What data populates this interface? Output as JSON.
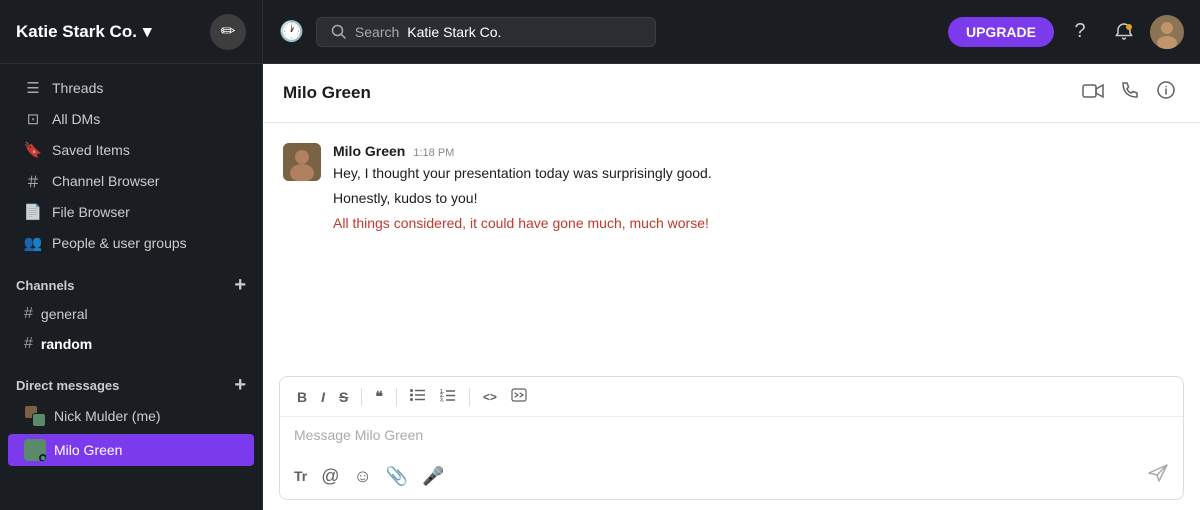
{
  "workspace": {
    "name": "Katie Stark Co.",
    "chevron": "▾"
  },
  "topbar": {
    "search_placeholder": "Search",
    "search_context": "Katie Stark Co.",
    "upgrade_label": "UPGRADE"
  },
  "sidebar": {
    "nav_items": [
      {
        "id": "threads",
        "label": "Threads",
        "icon": "☰"
      },
      {
        "id": "all-dms",
        "label": "All DMs",
        "icon": "⊞"
      },
      {
        "id": "saved-items",
        "label": "Saved Items",
        "icon": "🔖"
      },
      {
        "id": "channel-browser",
        "label": "Channel Browser",
        "icon": "＃"
      },
      {
        "id": "file-browser",
        "label": "File Browser",
        "icon": "📄"
      },
      {
        "id": "people",
        "label": "People & user groups",
        "icon": "👥"
      }
    ],
    "channels_section": "Channels",
    "channels": [
      {
        "id": "general",
        "name": "general",
        "active": false
      },
      {
        "id": "random",
        "name": "random",
        "active": false
      }
    ],
    "dms_section": "Direct messages",
    "dms": [
      {
        "id": "nick-mulder",
        "name": "Nick Mulder (me)",
        "active": false
      },
      {
        "id": "milo-green",
        "name": "Milo Green",
        "active": true
      }
    ]
  },
  "chat": {
    "contact_name": "Milo Green",
    "messages": [
      {
        "id": "msg1",
        "sender": "Milo Green",
        "time": "1:18 PM",
        "lines": [
          {
            "text": "Hey, I thought your presentation today was surprisingly good.",
            "colored": false
          },
          {
            "text": "Honestly, kudos to you!",
            "colored": false
          },
          {
            "text": "All things considered, it could have gone much, much worse!",
            "colored": true
          }
        ]
      }
    ],
    "input_placeholder": "Message Milo Green",
    "toolbar": {
      "bold": "B",
      "italic": "I",
      "strikethrough": "S",
      "quote": "❝",
      "bullet_list": "≡",
      "numbered_list": "≡",
      "code": "<>",
      "code_block": "⊡"
    }
  }
}
